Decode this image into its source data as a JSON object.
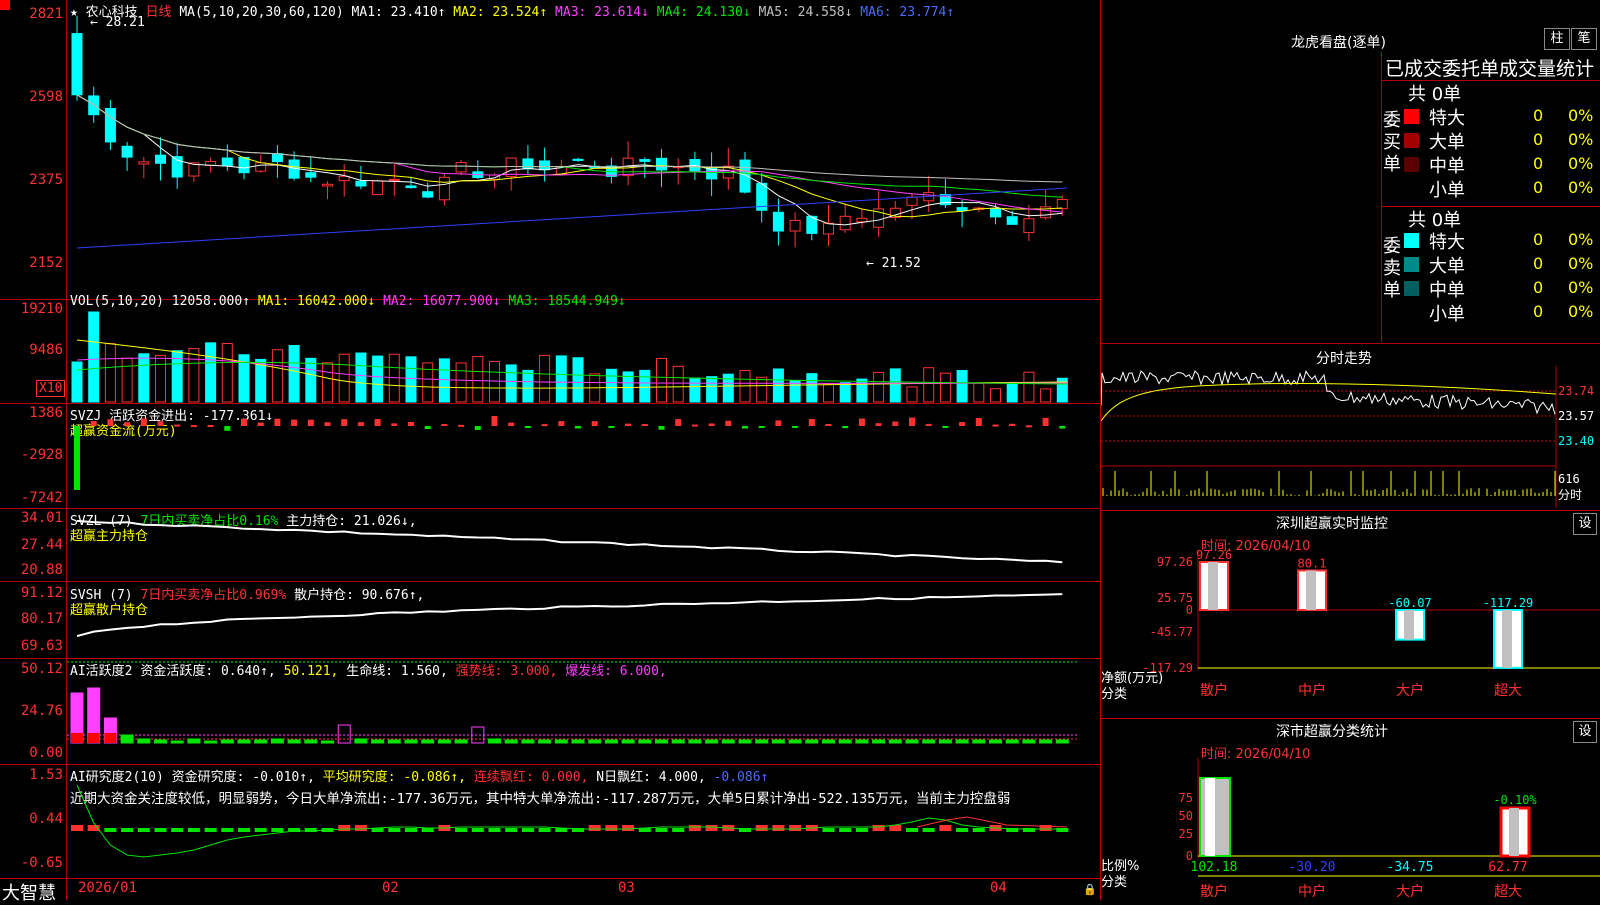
{
  "main": {
    "stock_name": "农心科技",
    "period": "日线",
    "ma_label": "MA(5,10,20,30,60,120)",
    "ma_values": [
      {
        "label": "MA1:",
        "value": "23.410↑",
        "color": "#ffffff"
      },
      {
        "label": "MA2:",
        "value": "23.524↑",
        "color": "#ffff00"
      },
      {
        "label": "MA3:",
        "value": "23.614↓",
        "color": "#ff40ff"
      },
      {
        "label": "MA4:",
        "value": "24.130↓",
        "color": "#00e400"
      },
      {
        "label": "MA5:",
        "value": "24.558↓",
        "color": "#c0c0c0"
      },
      {
        "label": "MA6:",
        "value": "23.774↑",
        "color": "#4a6bff"
      }
    ],
    "y_ticks": [
      "2821",
      "2598",
      "2375",
      "2152"
    ],
    "high_label": "28.21",
    "low_label": "21.52"
  },
  "vol": {
    "label": "VOL(5,10,20)",
    "value": "12058.000↑",
    "ma1": "MA1: 16042.000↓",
    "ma2": "MA2: 16077.900↓",
    "ma3": "MA3: 18544.949↓",
    "y_ticks": [
      "19210",
      "9486"
    ],
    "unit": "X10"
  },
  "svzj": {
    "label": "SVZJ",
    "line1": "活跃资金进出: -177.361↓",
    "line2": "超赢资金流(万元)",
    "y_ticks": [
      "1386",
      "-2928",
      "-7242"
    ]
  },
  "svzl": {
    "label": "SVZL (7)",
    "seg1": "7日内买卖净占比0.16%",
    "seg2": "主力持仓: 21.026↓,",
    "line2": "超赢主力持仓",
    "y_ticks": [
      "34.01",
      "27.44",
      "20.88"
    ]
  },
  "svsh": {
    "label": "SVSH (7)",
    "seg1": "7日内买卖净占比0.969%",
    "seg2": "散户持仓: 90.676↑,",
    "line2": "超赢散户持仓",
    "y_ticks": [
      "91.12",
      "80.17",
      "69.63"
    ]
  },
  "ai1": {
    "label": "AI活跃度2",
    "s1": "资金活跃度: 0.640↑,",
    "s2": "50.121,",
    "s3": "生命线: 1.560,",
    "s4": "强势线: 3.000,",
    "s5": "爆发线: 6.000,",
    "y_ticks": [
      "50.12",
      "24.76",
      "0.00"
    ]
  },
  "ai2": {
    "label": "AI研究度2(10)",
    "s1": "资金研究度: -0.010↑,",
    "s2": "平均研究度: -0.086↑,",
    "s3": "连续飘红: 0.000,",
    "s4": "N日飘红: 4.000,",
    "s5": "-0.086↑",
    "comment": "近期大资金关注度较低，明显弱势，今日大单净流出:-177.36万元，其中特大单净流出:-117.287万元，大单5日累计净出-522.135万元，当前主力控盘弱",
    "y_ticks": [
      "1.53",
      "0.44",
      "-0.65"
    ]
  },
  "xaxis": {
    "logo": "大智慧",
    "labels": [
      "2026/01",
      "02",
      "03",
      "04"
    ]
  },
  "right": {
    "lhkp_title": "龙虎看盘(逐单)",
    "btn_bar": "柱",
    "btn_pen": "笔",
    "stat_header": "已成交委托单成交量统计",
    "buy_total": "共 0单",
    "buy_side": "委买单",
    "sell_total": "共 0单",
    "sell_side": "委卖单",
    "rows": [
      {
        "name": "特大",
        "vol": "0",
        "pct": "0%",
        "color": "#ff0000"
      },
      {
        "name": "大单",
        "vol": "0",
        "pct": "0%",
        "color": "#a00000"
      },
      {
        "name": "中单",
        "vol": "0",
        "pct": "0%",
        "color": "#5a0000"
      },
      {
        "name": "小单",
        "vol": "0",
        "pct": "0%",
        "color": "#000000"
      }
    ],
    "sell_rows": [
      {
        "name": "特大",
        "vol": "0",
        "pct": "0%",
        "color": "#00ffff"
      },
      {
        "name": "大单",
        "vol": "0",
        "pct": "0%",
        "color": "#008a8a"
      },
      {
        "name": "中单",
        "vol": "0",
        "pct": "0%",
        "color": "#006060"
      },
      {
        "name": "小单",
        "vol": "0",
        "pct": "0%",
        "color": "#000000"
      }
    ],
    "intraday_title": "分时走势",
    "intraday_ticks": [
      "23.74",
      "23.57",
      "23.40",
      "616",
      "分时"
    ],
    "monitor_title": "深圳超赢实时监控",
    "monitor_btn": "设",
    "monitor_time": "时间: 2026/04/10",
    "monitor_yticks": [
      "97.26",
      "25.75",
      "0",
      "-45.77",
      "-117.29"
    ],
    "monitor_ylabel": "净额(万元)",
    "monitor_xlabel": "分类",
    "monitor_cats": [
      "散户",
      "中户",
      "大户",
      "超大"
    ],
    "monitor_vals": [
      "97.26",
      "80.1",
      "-60.07",
      "-117.29"
    ],
    "class_title": "深市超赢分类统计",
    "class_btn": "设",
    "class_time": "时间: 2026/04/10",
    "class_yticks": [
      "75",
      "50",
      "25",
      "0"
    ],
    "class_ylabel": "比例%",
    "class_xlabel": "分类",
    "class_top": "-0.10%",
    "class_vals": [
      "102.18",
      "-30.20",
      "-34.75",
      "62.77"
    ],
    "class_cats": [
      "散户",
      "中户",
      "大户",
      "超大"
    ]
  }
}
